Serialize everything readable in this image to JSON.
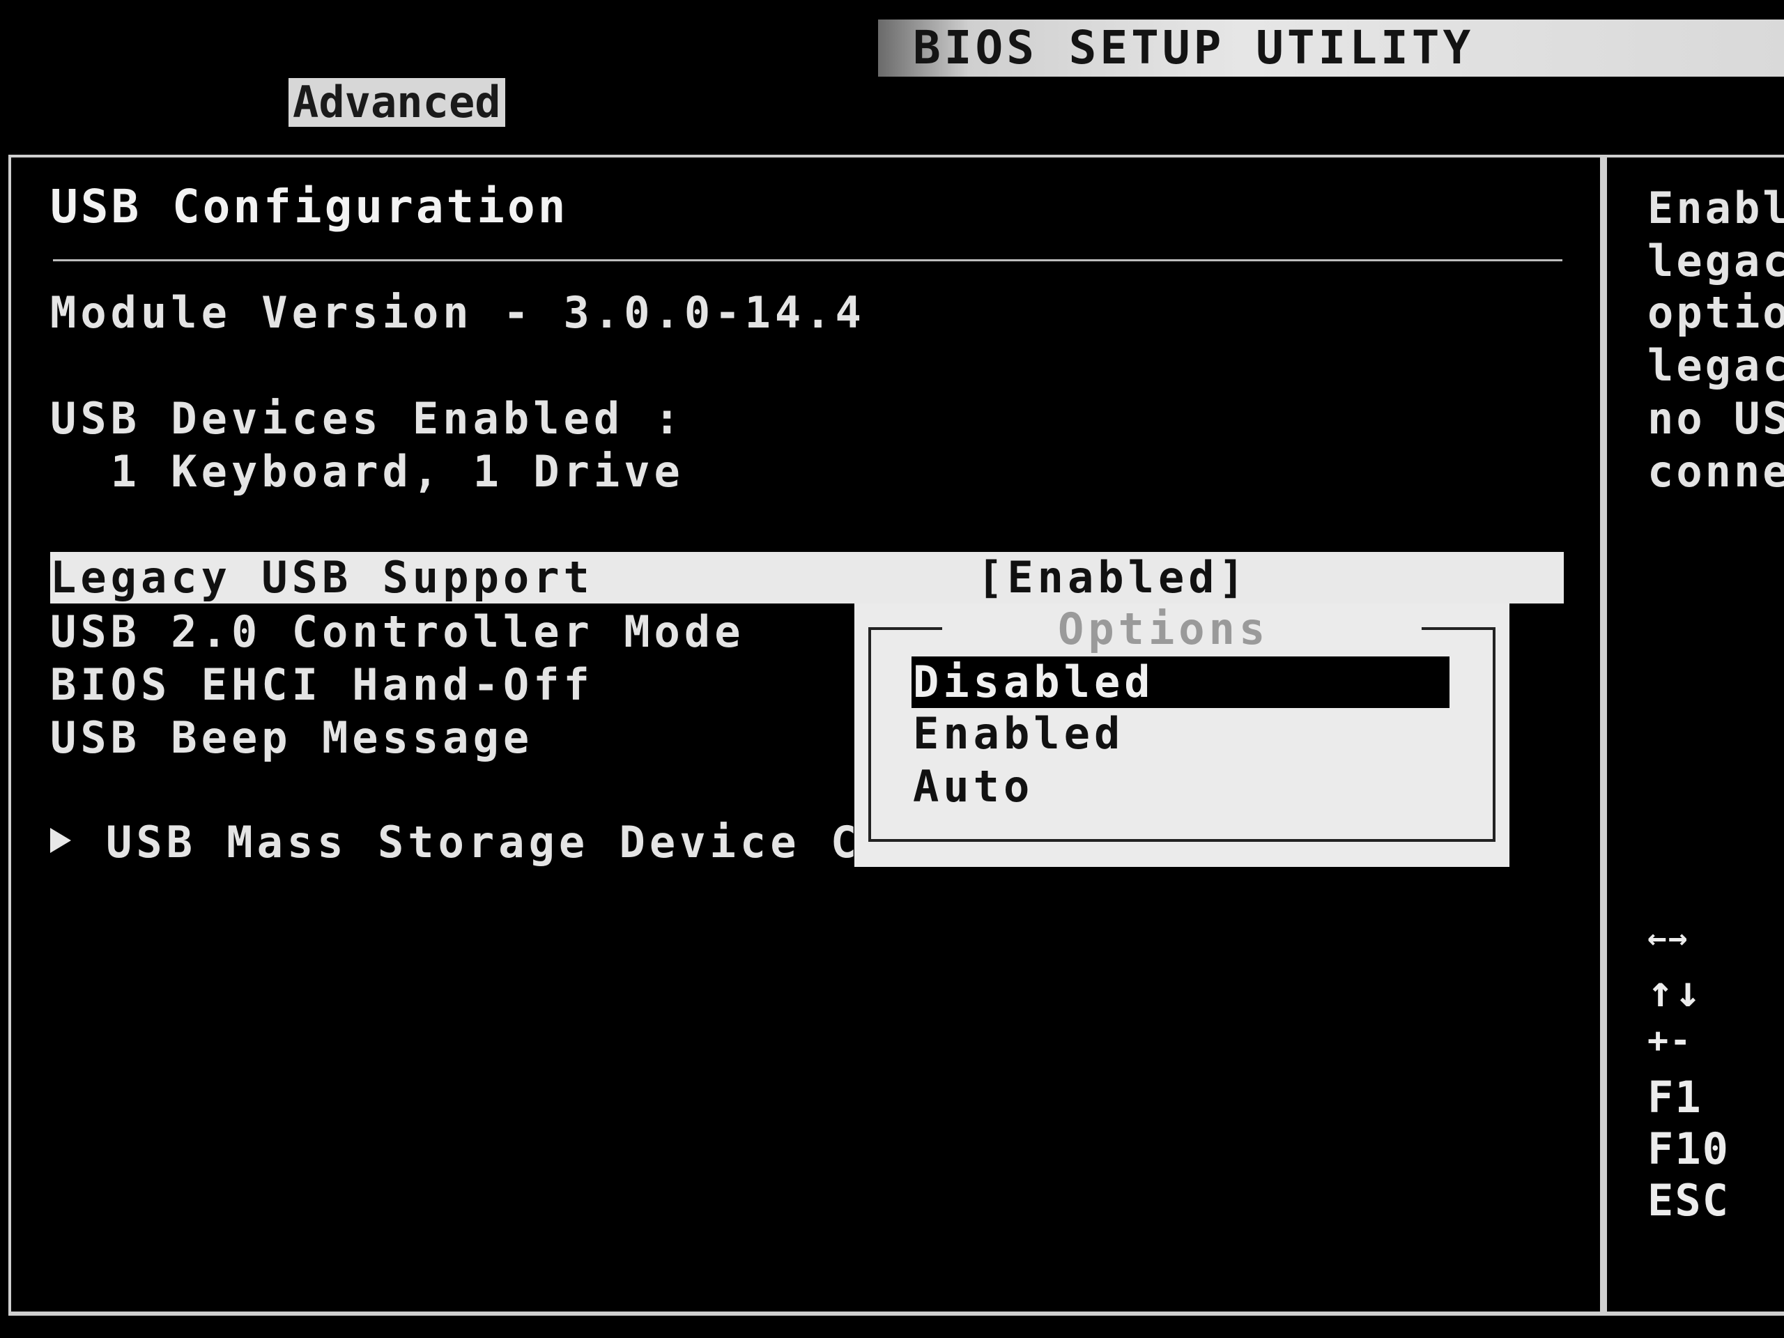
{
  "header": {
    "title": "BIOS SETUP UTILITY",
    "active_tab": "Advanced"
  },
  "main": {
    "section_title": "USB Configuration",
    "module_version": "Module Version - 3.0.0-14.4",
    "devices_label": "USB Devices Enabled :",
    "devices_value": "  1 Keyboard, 1 Drive",
    "items": [
      {
        "label": "Legacy USB Support",
        "value": "[Enabled]"
      },
      {
        "label": "USB 2.0 Controller Mode"
      },
      {
        "label": "BIOS EHCI Hand-Off"
      },
      {
        "label": "USB Beep Message"
      }
    ],
    "submenu_label": "USB Mass Storage Device C"
  },
  "popup": {
    "title": "Options",
    "options": [
      "Disabled",
      "Enabled",
      "Auto"
    ],
    "selected": "Disabled"
  },
  "help": {
    "lines": [
      "Enabl",
      "legac",
      "optio",
      "legac",
      "no US",
      "conne"
    ],
    "keys": [
      "←→",
      "↑↓",
      "+-",
      "F1",
      "F10",
      "ESC"
    ]
  },
  "colors": {
    "background": "#000000",
    "text": "#e4e4e4",
    "highlight": "#e9e9e9",
    "popup_bg": "#ebebeb"
  }
}
